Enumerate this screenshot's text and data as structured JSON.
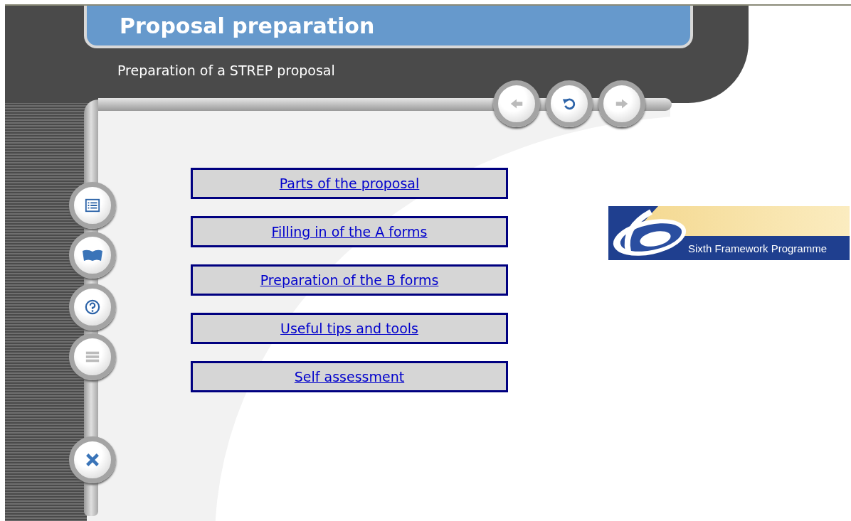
{
  "header": {
    "title": "Proposal preparation",
    "subtitle": "Preparation of a STREP proposal"
  },
  "nav_buttons": [
    {
      "kind": "back",
      "disabled": true
    },
    {
      "kind": "reload",
      "disabled": false
    },
    {
      "kind": "forward",
      "disabled": true
    }
  ],
  "side_buttons": [
    {
      "kind": "contents",
      "disabled": false
    },
    {
      "kind": "book",
      "disabled": false
    },
    {
      "kind": "help",
      "disabled": false
    },
    {
      "kind": "list",
      "disabled": true
    },
    {
      "kind": "close",
      "disabled": false
    }
  ],
  "menu": [
    {
      "label": "Parts of the proposal"
    },
    {
      "label": "Filling in of the A forms"
    },
    {
      "label": "Preparation of the B forms"
    },
    {
      "label": "Useful tips and tools"
    },
    {
      "label": "Self assessment"
    }
  ],
  "logo": {
    "text": "Sixth Framework Programme"
  }
}
